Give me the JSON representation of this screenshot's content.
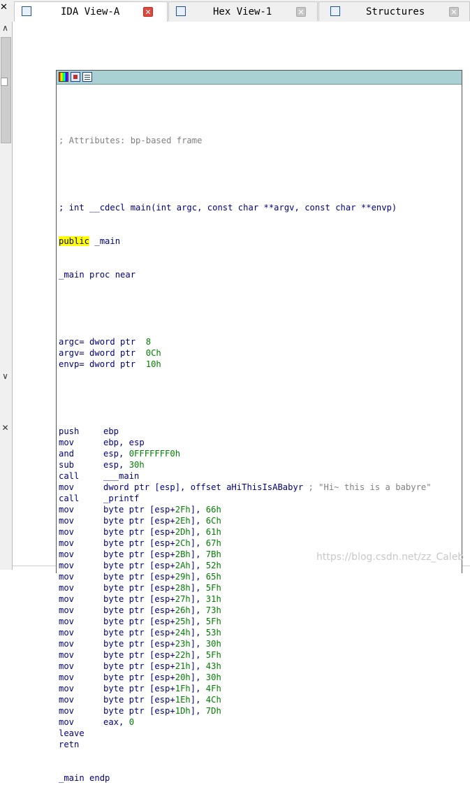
{
  "tabs": [
    {
      "label": "IDA View-A",
      "active": true,
      "icon": "disassembly-view-icon"
    },
    {
      "label": "Hex View-1",
      "active": false,
      "icon": "hex-view-icon"
    },
    {
      "label": "Structures",
      "active": false,
      "icon": "structures-icon"
    }
  ],
  "node_toolbar": [
    "node-color-icon",
    "graph-view-icon",
    "text-view-icon"
  ],
  "code": {
    "attributes_comment": "; Attributes: bp-based frame",
    "signature_comment": "; int __cdecl main(int argc, const char **argv, const char **envp)",
    "public_kw": "public",
    "public_name": " _main",
    "proc_line": "_main proc near",
    "args": [
      {
        "name": "argc",
        "text": "= dword ptr  ",
        "value": "8"
      },
      {
        "name": "argv",
        "text": "= dword ptr  ",
        "value": "0Ch"
      },
      {
        "name": "envp",
        "text": "= dword ptr  ",
        "value": "10h"
      }
    ],
    "prologue": [
      {
        "mn": "push",
        "op": "ebp",
        "imm": ""
      },
      {
        "mn": "mov",
        "op": "ebp, esp",
        "imm": ""
      },
      {
        "mn": "and",
        "op": "esp, ",
        "imm": "0FFFFFFF0h"
      },
      {
        "mn": "sub",
        "op": "esp, ",
        "imm": "30h"
      },
      {
        "mn": "call",
        "op": "___main",
        "imm": ""
      },
      {
        "mn": "mov",
        "op": "dword ptr [esp], offset aHiThisIsABabyr ",
        "imm": "",
        "comment": "; \"Hi~ this is a babyre\""
      },
      {
        "mn": "call",
        "op": "_printf",
        "imm": ""
      }
    ],
    "byte_moves": [
      {
        "offset": "2Fh",
        "value": "66h"
      },
      {
        "offset": "2Eh",
        "value": "6Ch"
      },
      {
        "offset": "2Dh",
        "value": "61h"
      },
      {
        "offset": "2Ch",
        "value": "67h"
      },
      {
        "offset": "2Bh",
        "value": "7Bh"
      },
      {
        "offset": "2Ah",
        "value": "52h"
      },
      {
        "offset": "29h",
        "value": "65h"
      },
      {
        "offset": "28h",
        "value": "5Fh"
      },
      {
        "offset": "27h",
        "value": "31h"
      },
      {
        "offset": "26h",
        "value": "73h"
      },
      {
        "offset": "25h",
        "value": "5Fh"
      },
      {
        "offset": "24h",
        "value": "53h"
      },
      {
        "offset": "23h",
        "value": "30h"
      },
      {
        "offset": "22h",
        "value": "5Fh"
      },
      {
        "offset": "21h",
        "value": "43h"
      },
      {
        "offset": "20h",
        "value": "30h"
      },
      {
        "offset": "1Fh",
        "value": "4Fh"
      },
      {
        "offset": "1Eh",
        "value": "4Ch"
      },
      {
        "offset": "1Dh",
        "value": "7Dh"
      }
    ],
    "byte_mov_prefix": "byte ptr [esp+",
    "epilogue": [
      {
        "mn": "mov",
        "op": "eax, ",
        "imm": "0"
      },
      {
        "mn": "leave",
        "op": "",
        "imm": ""
      },
      {
        "mn": "retn",
        "op": "",
        "imm": ""
      }
    ],
    "endp_line": "_main endp"
  },
  "watermark": "https://blog.csdn.net/zz_Caleb"
}
